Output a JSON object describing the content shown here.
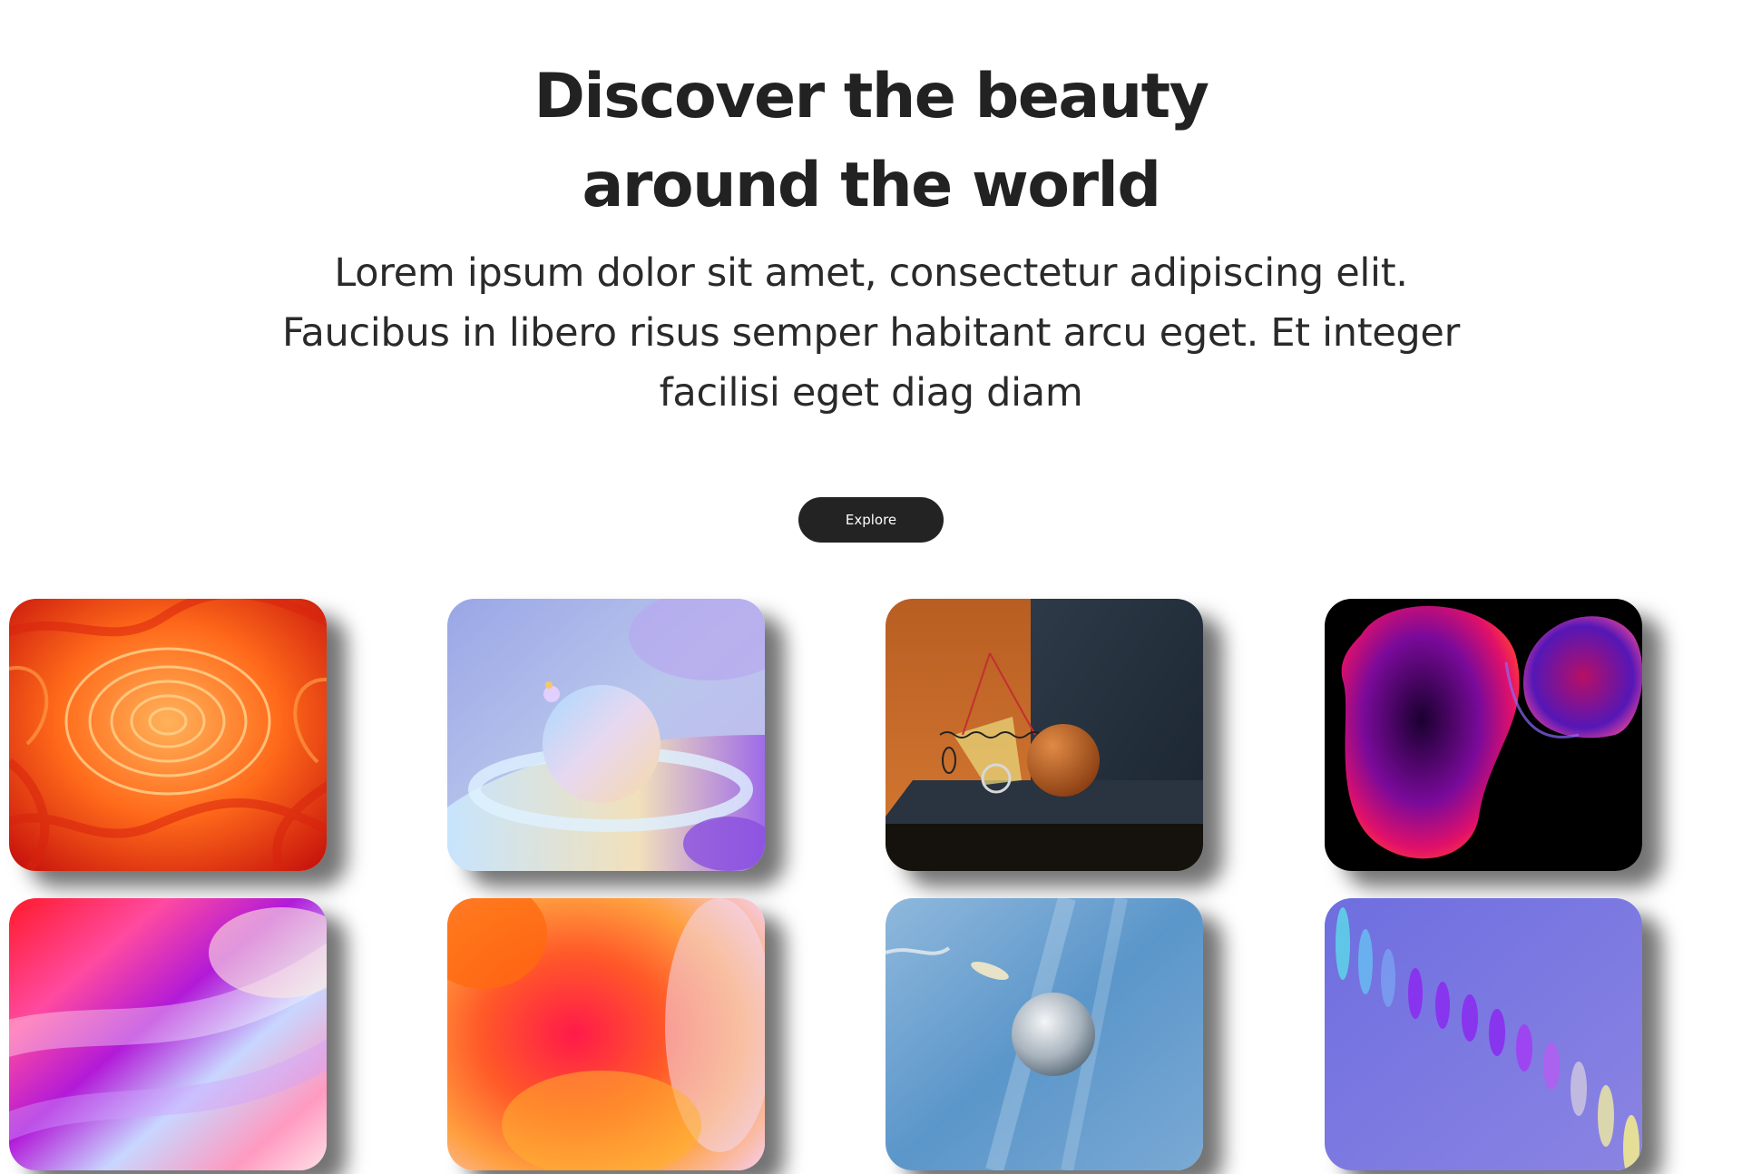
{
  "hero": {
    "title_line1": "Discover the beauty",
    "title_line2": "around the world",
    "desc_line1": "Lorem ipsum dolor sit amet, consectetur adipiscing elit.",
    "desc_line2": "Faucibus in libero risus semper habitant arcu eget. Et integer",
    "desc_line3": "facilisi eget diag diam",
    "button_label": "Explore"
  },
  "colors": {
    "text": "#222222",
    "button_bg": "#232323",
    "button_text": "#ffffff",
    "background": "#ffffff"
  },
  "gallery": {
    "images": [
      {
        "subject": "orange-red paper swirl"
      },
      {
        "subject": "pastel sphere with ring"
      },
      {
        "subject": "orange sphere in dark room"
      },
      {
        "subject": "neon blob on black"
      },
      {
        "subject": "pink purple gradient"
      },
      {
        "subject": "orange red gradient"
      },
      {
        "subject": "glass sphere in blue sky"
      },
      {
        "subject": "violet spiral on purple"
      }
    ]
  }
}
